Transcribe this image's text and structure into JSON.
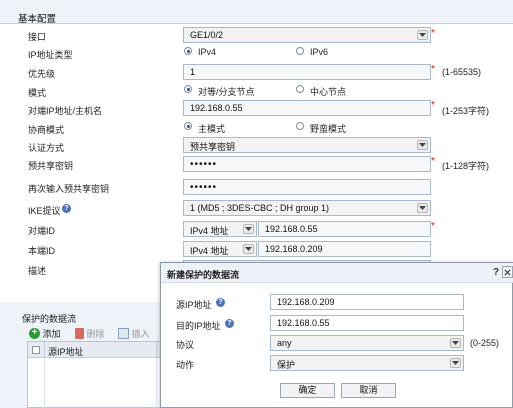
{
  "section": {
    "title": "基本配置"
  },
  "interface": {
    "label": "接口",
    "value": "GE1/0/2"
  },
  "ip_type": {
    "label": "IP地址类型",
    "options": [
      "IPv4",
      "IPv6"
    ],
    "selected": "IPv4"
  },
  "priority": {
    "label": "优先级",
    "value": "1",
    "hint": "(1-65535)"
  },
  "mode": {
    "label": "模式",
    "options": [
      "对等/分支节点",
      "中心节点"
    ],
    "selected": "对等/分支节点"
  },
  "peer_ip": {
    "label": "对端IP地址/主机名",
    "value": "192.168.0.55",
    "hint": "(1-253字符)"
  },
  "negotiation": {
    "label": "协商模式",
    "options": [
      "主模式",
      "野蛮模式"
    ],
    "selected": "主模式"
  },
  "auth": {
    "label": "认证方式",
    "value": "预共享密钥"
  },
  "psk": {
    "label": "预共享密钥",
    "value": "••••••",
    "hint": "(1-128字符)"
  },
  "psk_confirm": {
    "label": "再次输入预共享密钥",
    "value": "••••••"
  },
  "ike": {
    "label": "IKE提议",
    "help": "?",
    "value": "1 (MD5 ; 3DES-CBC ; DH group 1)"
  },
  "peer_id": {
    "label": "对端ID",
    "type": "IPv4 地址",
    "value": "192.168.0.55"
  },
  "local_id": {
    "label": "本端ID",
    "type": "IPv4 地址",
    "value": "192.168.0.209"
  },
  "desc": {
    "label": "描述"
  },
  "protected": {
    "title": "保护的数据流",
    "toolbar": {
      "add": "添加",
      "delete": "删除",
      "insert": "插入"
    },
    "columns": [
      "源IP地址"
    ]
  },
  "dialog": {
    "title": "新建保护的数据流",
    "help": "?",
    "src_ip": {
      "label": "源IP地址",
      "value": "192.168.0.209"
    },
    "dst_ip": {
      "label": "目的IP地址",
      "value": "192.168.0.55"
    },
    "protocol": {
      "label": "协议",
      "value": "any",
      "hint": "(0-255)"
    },
    "action": {
      "label": "动作",
      "value": "保护"
    },
    "ok": "确定",
    "cancel": "取消"
  },
  "colors": {
    "header_bg": "#eef3fa",
    "accent": "#274d8a",
    "required": "#e01010",
    "help_icon": "#4b73b8"
  },
  "icons": [
    "chevron-down-icon",
    "help-icon",
    "add-icon",
    "delete-icon",
    "insert-icon"
  ]
}
